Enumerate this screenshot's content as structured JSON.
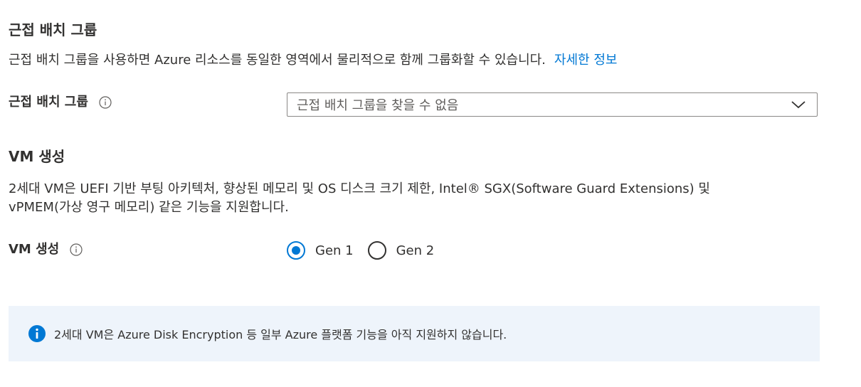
{
  "proximity_section": {
    "heading": "근접 배치 그룹",
    "description": "근접 배치 그룹을 사용하면 Azure 리소스를 동일한 영역에서 물리적으로 함께 그룹화할 수 있습니다.",
    "learn_more_link": "자세한 정보",
    "field_label": "근접 배치 그룹",
    "dropdown_value": "근접 배치 그룹을 찾을 수 없음"
  },
  "vm_generation_section": {
    "heading": "VM 생성",
    "description_line1": "2세대 VM은 UEFI 기반 부팅 아키텍처, 향상된 메모리 및 OS 디스크 크기 제한, Intel® SGX(Software Guard Extensions) 및",
    "description_line2": "vPMEM(가상 영구 메모리) 같은 기능을 지원합니다.",
    "field_label": "VM 생성",
    "options": [
      {
        "label": "Gen 1",
        "selected": true
      },
      {
        "label": "Gen 2",
        "selected": false
      }
    ]
  },
  "info_banner": {
    "text": "2세대 VM은 Azure Disk Encryption 등 일부 Azure 플랫폼 기능을 아직 지원하지 않습니다."
  },
  "colors": {
    "accent": "#0078d4",
    "banner_background": "#eef4fb",
    "text": "#323130"
  },
  "icons": {
    "field_info": "info-circle-outline-icon",
    "dropdown": "chevron-down-icon",
    "banner": "info-filled-icon"
  }
}
